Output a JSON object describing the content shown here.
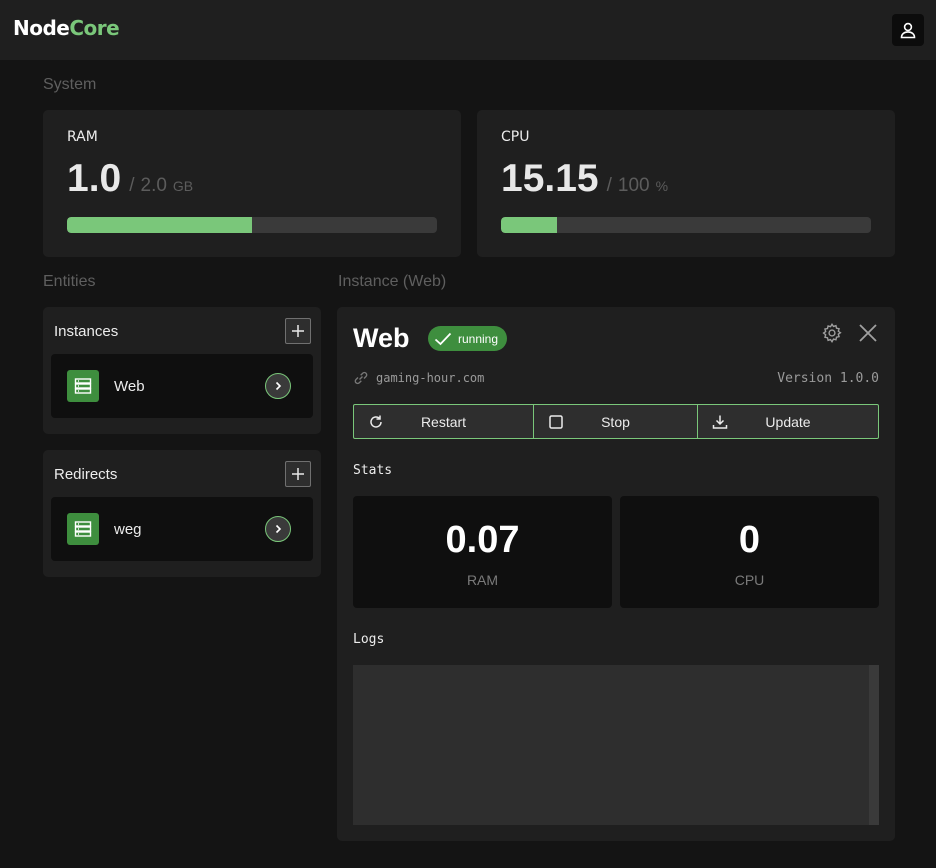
{
  "app": {
    "logo_part1": "Node",
    "logo_part2": "Core"
  },
  "system": {
    "label": "System",
    "ram": {
      "title": "RAM",
      "value": "1.0",
      "separator": "/",
      "max": "2.0",
      "unit": "GB",
      "fraction": 0.5
    },
    "cpu": {
      "title": "CPU",
      "value": "15.15",
      "separator": "/",
      "max": "100",
      "unit": "%",
      "fraction": 0.1515
    }
  },
  "entities": {
    "label": "Entities",
    "instances": {
      "title": "Instances",
      "items": [
        {
          "name": "Web"
        }
      ]
    },
    "redirects": {
      "title": "Redirects",
      "items": [
        {
          "name": "weg"
        }
      ]
    }
  },
  "instance": {
    "section_label": "Instance (Web)",
    "name": "Web",
    "status": "running",
    "domain": "gaming-hour.com",
    "version": "Version 1.0.0",
    "actions": {
      "restart": "Restart",
      "stop": "Stop",
      "update": "Update"
    },
    "stats_label": "Stats",
    "stats": [
      {
        "value": "0.07",
        "label": "RAM"
      },
      {
        "value": "0",
        "label": "CPU"
      }
    ],
    "logs_label": "Logs"
  },
  "colors": {
    "accent": "#7ac77a",
    "accent_dark": "#3e8e3e",
    "background": "#141414",
    "card": "#1f1f1f"
  },
  "icons": [
    "user-icon",
    "plus-icon",
    "server-icon",
    "chevron-right-icon",
    "check-icon",
    "gear-icon",
    "close-icon",
    "link-icon",
    "restart-icon",
    "stop-icon",
    "download-icon"
  ]
}
